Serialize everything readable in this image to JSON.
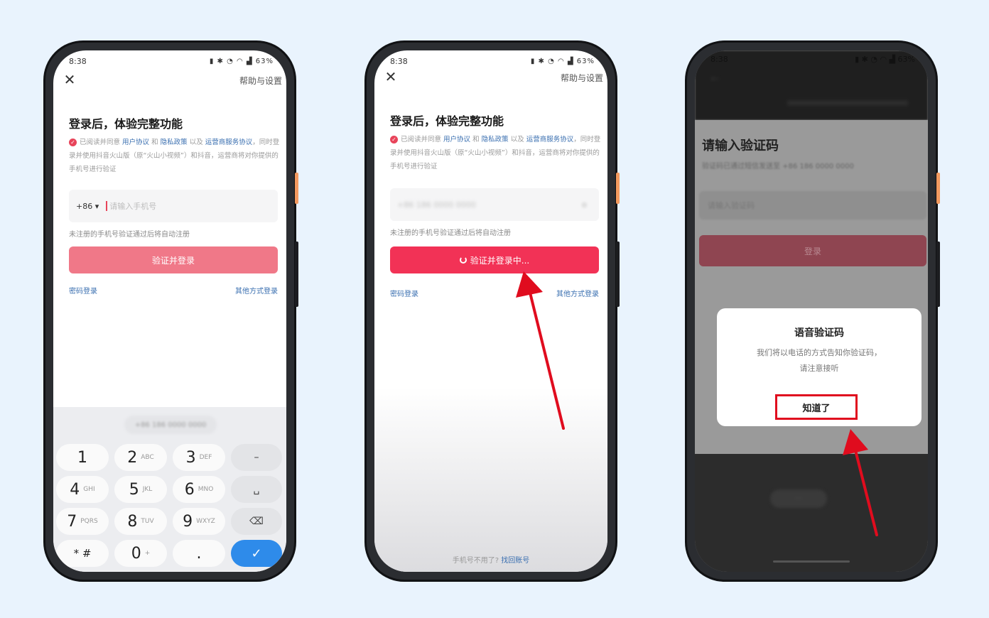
{
  "colors": {
    "background": "#e9f3fd",
    "primary_cta": "#f23256",
    "link": "#3a6fb0",
    "annotation_red": "#e00c1e"
  },
  "phone1": {
    "status": {
      "time": "8:38",
      "right": "63%"
    },
    "close_icon": "close-icon",
    "help": "帮助与设置",
    "title": "登录后，体验完整功能",
    "agreement": {
      "prefix": "已阅读并同意",
      "user_agreement": "用户协议",
      "and": "和",
      "privacy": "隐私政策",
      "and2": "以及",
      "carrier": "运营商服务协议",
      "rest": "，同时登录并使用抖音火山版（原“火山小视频”）和抖音，运营商将对你提供的手机号进行验证"
    },
    "country_code": "+86",
    "phone_placeholder": "请输入手机号",
    "hint": "未注册的手机号验证通过后将自动注册",
    "cta": "验证并登录",
    "password_login": "密码登录",
    "other_login": "其他方式登录",
    "keyboard": {
      "suggestion": "+86 186 0000 0000",
      "keys": [
        {
          "main": "1",
          "sub": ""
        },
        {
          "main": "2",
          "sub": "ABC"
        },
        {
          "main": "3",
          "sub": "DEF"
        },
        {
          "main": "–",
          "sub": ""
        },
        {
          "main": "4",
          "sub": "GHI"
        },
        {
          "main": "5",
          "sub": "JKL"
        },
        {
          "main": "6",
          "sub": "MNO"
        },
        {
          "main": "␣",
          "sub": ""
        },
        {
          "main": "7",
          "sub": "PQRS"
        },
        {
          "main": "8",
          "sub": "TUV"
        },
        {
          "main": "9",
          "sub": "WXYZ"
        },
        {
          "main": "⌫",
          "sub": ""
        },
        {
          "main": "* #",
          "sub": ""
        },
        {
          "main": "0",
          "sub": "+"
        },
        {
          "main": ".",
          "sub": ""
        },
        {
          "main": "✓",
          "sub": ""
        }
      ]
    }
  },
  "phone2": {
    "status": {
      "time": "8:38",
      "right": "63%"
    },
    "help": "帮助与设置",
    "title": "登录后，体验完整功能",
    "agreement": {
      "prefix": "已阅读并同意",
      "user_agreement": "用户协议",
      "and": "和",
      "privacy": "隐私政策",
      "and2": "以及",
      "carrier": "运营商服务协议",
      "rest": "，同时登录并使用抖音火山版（原“火山小视频”）和抖音，运营商将对你提供的手机号进行验证"
    },
    "phone_value": "+86  186 0000 0000",
    "hint": "未注册的手机号验证通过后将自动注册",
    "cta": "验证并登录中...",
    "password_login": "密码登录",
    "other_login": "其他方式登录",
    "footer_text": "手机号不用了?",
    "footer_link": "找回账号"
  },
  "phone3": {
    "status": {
      "time": "8:38",
      "right": "63%"
    },
    "title": "请输入验证码",
    "subtitle": "验证码已通过短信发送至 +86 186 0000 0000",
    "code_placeholder": "请输入验证码",
    "login_button": "登录",
    "dialog": {
      "title": "语音验证码",
      "message_line1": "我们将以电话的方式告知你验证码，",
      "message_line2": "请注意接听",
      "button": "知道了"
    }
  }
}
